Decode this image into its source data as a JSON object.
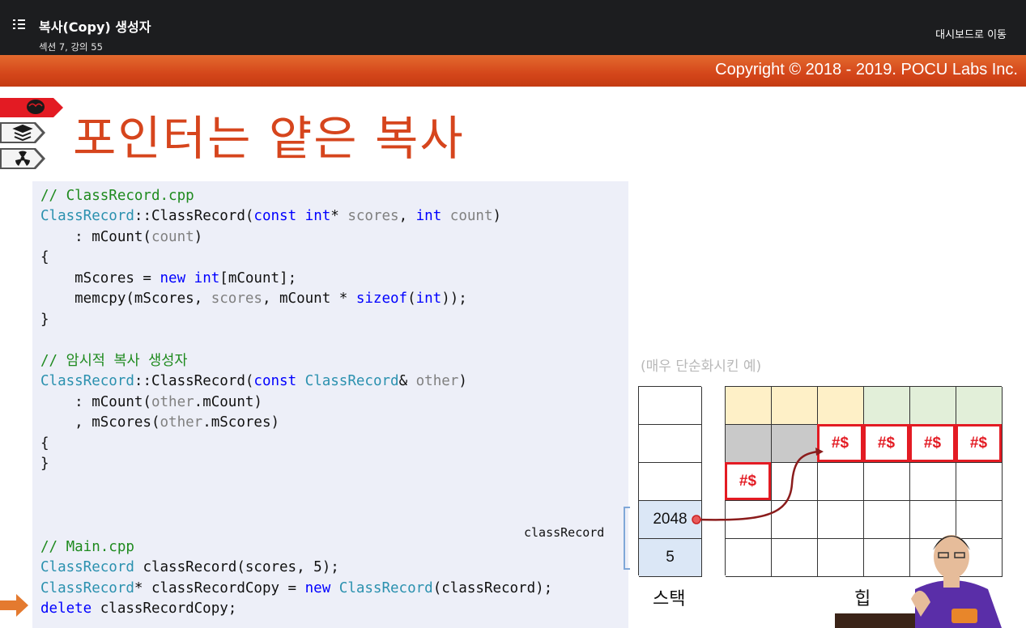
{
  "topbar": {
    "lecture_title": "복사(Copy) 생성자",
    "lecture_subtitle": "섹션 7, 강의 55",
    "dashboard_link": "대시보드로 이동"
  },
  "slide": {
    "copyright": "Copyright © 2018 - 2019. POCU Labs Inc.",
    "title": "포인터는 얕은 복사",
    "diagram": {
      "note": "(매우 단순화시킨 예)",
      "variable_label": "classRecord",
      "stack_values": [
        "2048",
        "5"
      ],
      "heap_block_text": "#$",
      "stack_label": "스택",
      "heap_label": "힙",
      "colors": {
        "header_yellow": "#fef0c7",
        "header_green": "#e2efd9",
        "filled_gray": "#c9c9c9",
        "block_red": "#e31b23",
        "stack_blue": "#dbe7f6",
        "arrow": "#8b1c1c"
      }
    },
    "code": {
      "l1_comment": "// ClassRecord.cpp",
      "l2_type": "ClassRecord",
      "l2_scope": "::ClassRecord(",
      "l2_const": "const",
      "l2_int": "int",
      "l2_star": "* ",
      "l2_scores": "scores",
      "l2_comma": ", ",
      "l2_int2": "int",
      "l2_count": "count",
      "l2_close": ")",
      "l3_pre": "    : mCount(",
      "l3_count": "count",
      "l3_post": ")",
      "l4": "{",
      "l5_pre": "    mScores = ",
      "l5_new": "new",
      "l5_int": "int",
      "l5_post": "[mCount];",
      "l6_pre": "    memcpy(mScores, ",
      "l6_scores": "scores",
      "l6_mid": ", mCount * ",
      "l6_sizeof": "sizeof",
      "l6_open": "(",
      "l6_int": "int",
      "l6_post": "));",
      "l7": "}",
      "l8_comment": "// 암시적 복사 생성자",
      "l9_type": "ClassRecord",
      "l9_scope": "::ClassRecord(",
      "l9_const": "const",
      "l9_type2": "ClassRecord",
      "l9_amp": "& ",
      "l9_other": "other",
      "l9_close": ")",
      "l10_pre": "    : mCount(",
      "l10_other": "other",
      "l10_post": ".mCount)",
      "l11_pre": "    , mScores(",
      "l11_other": "other",
      "l11_post": ".mScores)",
      "l12": "{",
      "l13": "}",
      "l14_comment": "// Main.cpp",
      "l15_type": "ClassRecord",
      "l15_post": " classRecord(scores, 5);",
      "l16_type": "ClassRecord",
      "l16_mid": "* classRecordCopy = ",
      "l16_new": "new",
      "l16_type2": "ClassRecord",
      "l16_post": "(classRecord);",
      "l17_delete": "delete",
      "l17_post": " classRecordCopy;"
    }
  },
  "icons": [
    "menu-list-icon",
    "brain-icon",
    "layers-icon",
    "radiation-icon",
    "current-line-arrow-icon"
  ]
}
